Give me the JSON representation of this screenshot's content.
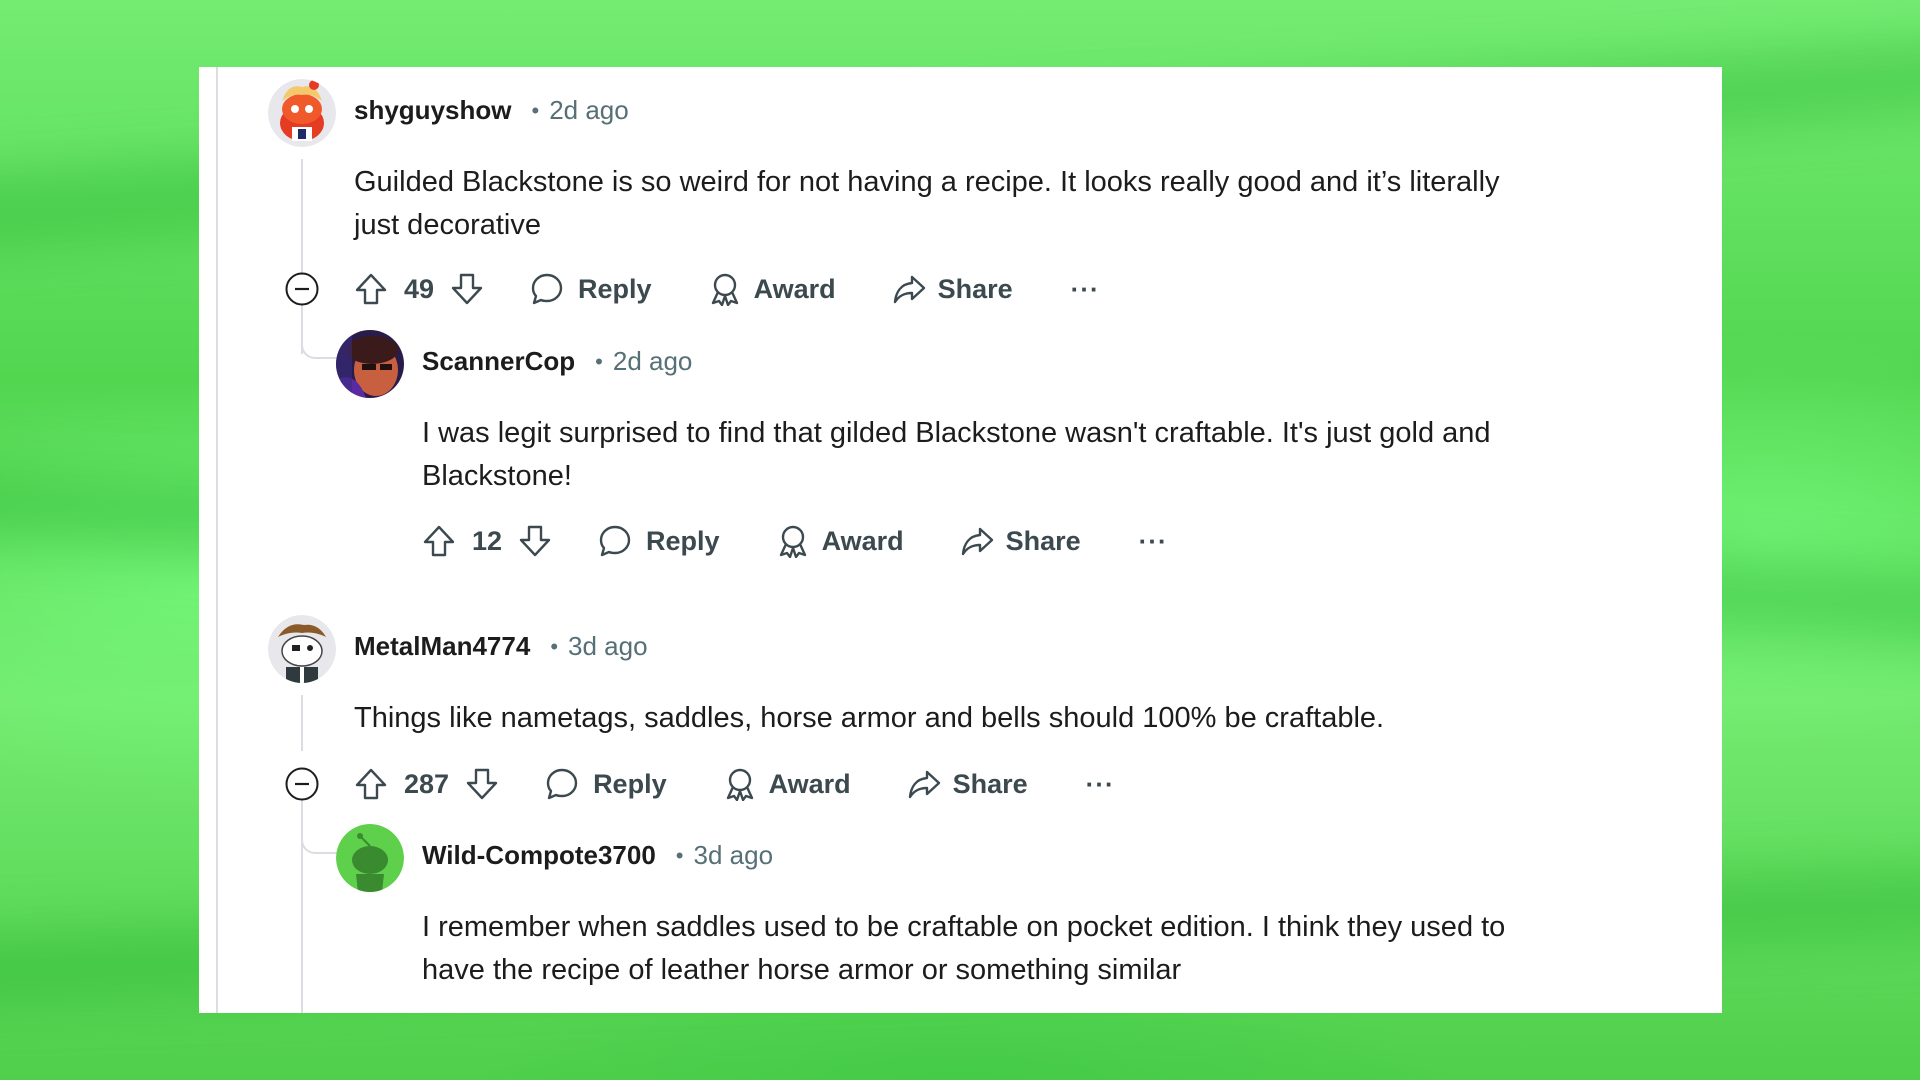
{
  "comments": [
    {
      "username": "shyguyshow",
      "separator": "•",
      "time": "2d ago",
      "body": "Guilded Blackstone is so weird for not having a recipe. It looks really good and it’s literally just decorative",
      "score": "49",
      "avatar_icon": "snoo-red-hat-avatar-icon"
    },
    {
      "username": "ScannerCop",
      "separator": "•",
      "time": "2d ago",
      "body": "I was legit surprised to find that gilded Blackstone wasn't craftable. It's just gold and Blackstone!",
      "score": "12",
      "avatar_icon": "photo-avatar-icon"
    },
    {
      "username": "MetalMan4774",
      "separator": "•",
      "time": "3d ago",
      "body": "Things like nametags, saddles, horse armor and bells should 100% be craftable.",
      "score": "287",
      "avatar_icon": "snoo-pirate-avatar-icon"
    },
    {
      "username": "Wild-Compote3700",
      "separator": "•",
      "time": "3d ago",
      "body": "I remember when saddles used to be craftable on pocket edition. I think they used to have the recipe of leather horse armor or something similar",
      "avatar_icon": "snoo-green-avatar-icon"
    }
  ],
  "actions": {
    "reply": "Reply",
    "award": "Award",
    "share": "Share",
    "more": "···"
  },
  "colors": {
    "background_green": "#5fe05c",
    "card": "#ffffff",
    "text": "#1c1c1c",
    "muted": "#576f76",
    "thread_line": "#dadde1"
  }
}
